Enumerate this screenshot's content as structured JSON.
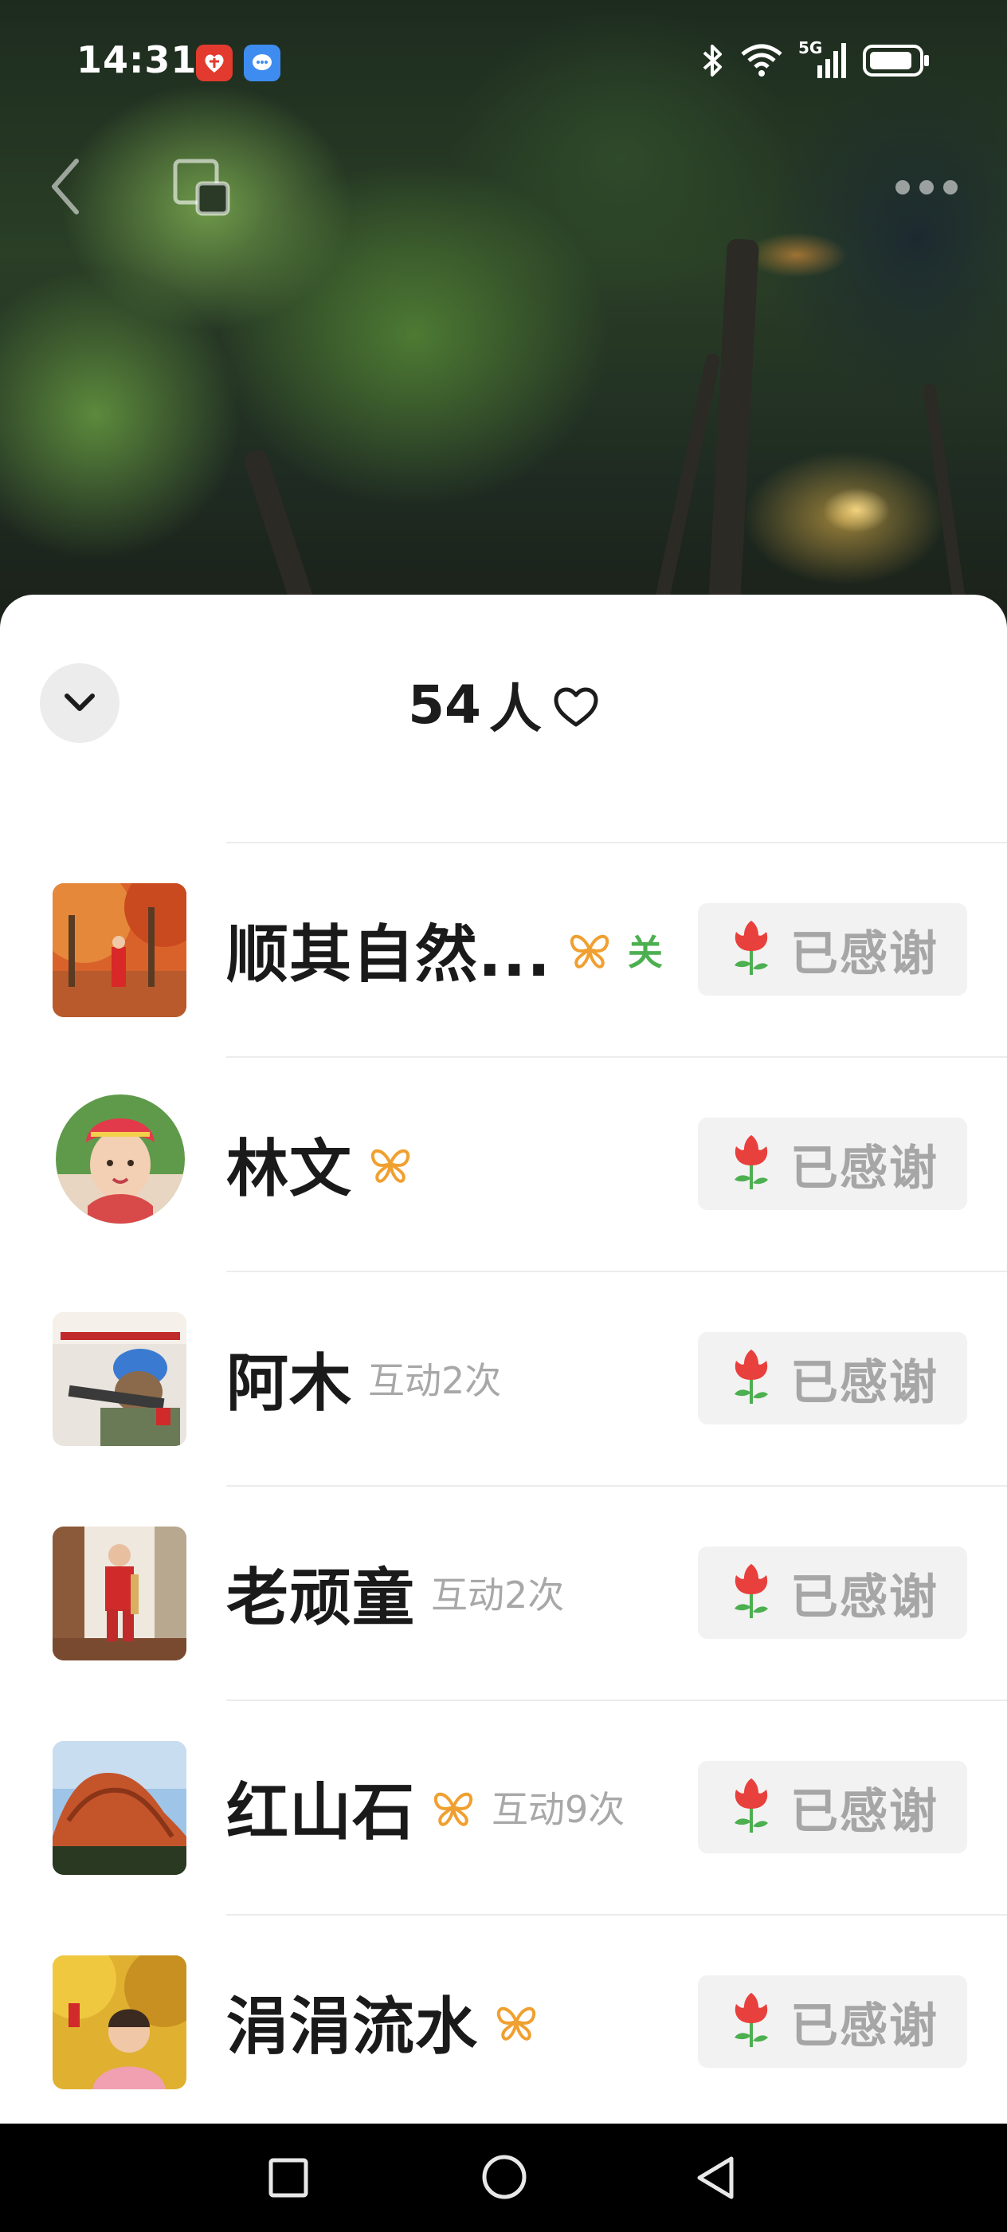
{
  "status_bar": {
    "time": "14:31",
    "network": "5G"
  },
  "sheet": {
    "like_count": "54",
    "like_unit": "人"
  },
  "users": [
    {
      "name": "顺其自然...",
      "has_badge": true,
      "follow_tag": "关",
      "interactions": "",
      "button_label": "已感谢"
    },
    {
      "name": "林文",
      "has_badge": true,
      "follow_tag": "",
      "interactions": "",
      "button_label": "已感谢"
    },
    {
      "name": "阿木",
      "has_badge": false,
      "follow_tag": "",
      "interactions": "互动2次",
      "button_label": "已感谢"
    },
    {
      "name": "老顽童",
      "has_badge": false,
      "follow_tag": "",
      "interactions": "互动2次",
      "button_label": "已感谢"
    },
    {
      "name": "红山石",
      "has_badge": true,
      "follow_tag": "",
      "interactions": "互动9次",
      "button_label": "已感谢"
    },
    {
      "name": "涓涓流水",
      "has_badge": true,
      "follow_tag": "",
      "interactions": "",
      "button_label": "已感谢"
    }
  ],
  "colors": {
    "badge_orange": "#f0a030",
    "follow_green": "#4caf50",
    "rose_red": "#e8403c",
    "leaf_green": "#4caf50"
  },
  "icons": {
    "back": "chevron-left-icon",
    "multi_window": "multi-window-icon",
    "more": "more-dots-icon",
    "collapse": "chevron-down-icon",
    "like": "heart-outline-icon",
    "badge": "butterfly-badge-icon",
    "thank": "rose-icon"
  }
}
